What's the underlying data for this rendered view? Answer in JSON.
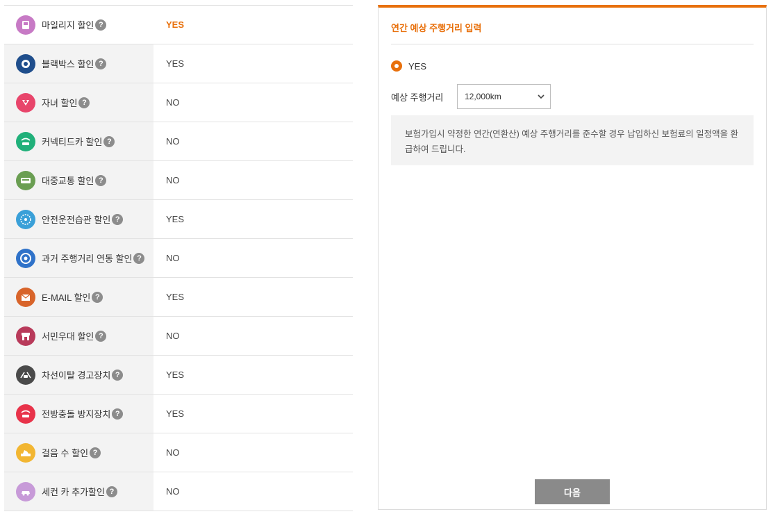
{
  "discounts": [
    {
      "name": "마일리지 할인",
      "value": "YES",
      "icon": "mileage-icon",
      "color": "#c77ac5",
      "highlight": true
    },
    {
      "name": "블랙박스 할인",
      "value": "YES",
      "icon": "blackbox-icon",
      "color": "#1f4e8c",
      "highlight": false
    },
    {
      "name": "자녀 할인",
      "value": "NO",
      "icon": "child-icon",
      "color": "#e8456b",
      "highlight": false
    },
    {
      "name": "커넥티드카 할인",
      "value": "NO",
      "icon": "connected-car-icon",
      "color": "#20b07a",
      "highlight": false
    },
    {
      "name": "대중교통 할인",
      "value": "NO",
      "icon": "bus-icon",
      "color": "#6a9e52",
      "highlight": false
    },
    {
      "name": "안전운전습관 할인",
      "value": "YES",
      "icon": "safe-driving-icon",
      "color": "#3aa0d8",
      "highlight": false
    },
    {
      "name": "과거 주행거리 연동 할인",
      "value": "NO",
      "icon": "odometer-icon",
      "color": "#2f72c9",
      "highlight": false
    },
    {
      "name": "E-MAIL 할인",
      "value": "YES",
      "icon": "email-icon",
      "color": "#d8642a",
      "highlight": false
    },
    {
      "name": "서민우대 할인",
      "value": "NO",
      "icon": "store-icon",
      "color": "#b83a5a",
      "highlight": false
    },
    {
      "name": "차선이탈 경고장치",
      "value": "YES",
      "icon": "lane-warning-icon",
      "color": "#4a4a4a",
      "highlight": false
    },
    {
      "name": "전방충돌 방지장치",
      "value": "YES",
      "icon": "collision-icon",
      "color": "#e8334a",
      "highlight": false
    },
    {
      "name": "걸음 수 할인",
      "value": "NO",
      "icon": "walking-icon",
      "color": "#f2b632",
      "highlight": false
    },
    {
      "name": "세컨 카 추가할인",
      "value": "NO",
      "icon": "second-car-icon",
      "color": "#c79ad8",
      "highlight": false
    }
  ],
  "help_glyph": "?",
  "panel": {
    "title": "연간 예상 주행거리 입력",
    "radio_label": "YES",
    "field_label": "예상 주행거리",
    "select_value": "12,000km",
    "notice": "보험가입시 약정한 연간(연환산) 예상 주행거리를 준수할 경우 납입하신 보험료의 일정액을 환급하여 드립니다.",
    "next_button": "다음"
  },
  "colors": {
    "accent": "#e8700c",
    "button": "#8a8a8a"
  }
}
